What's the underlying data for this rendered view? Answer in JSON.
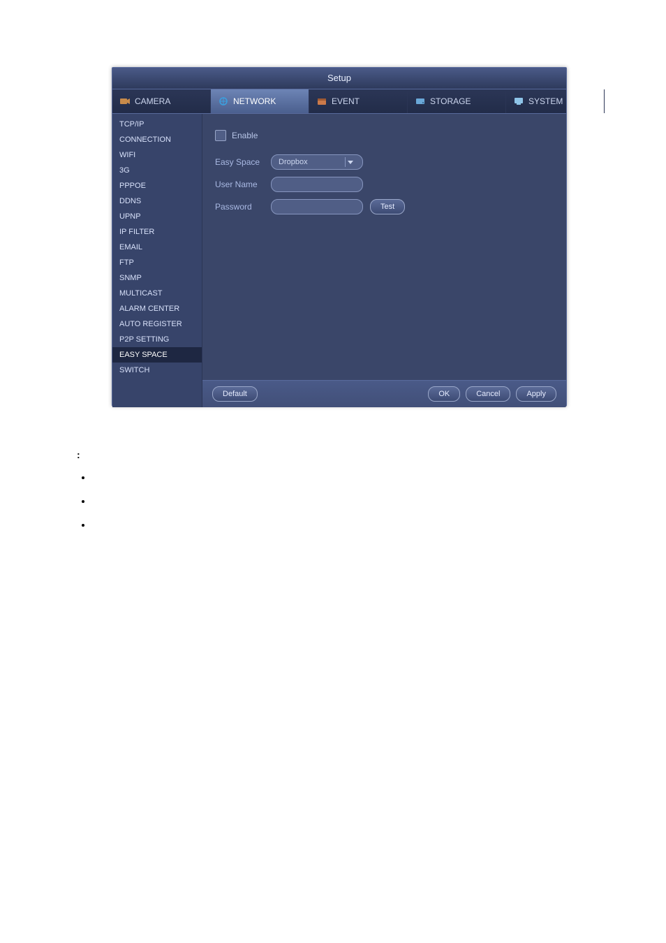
{
  "window": {
    "title": "Setup"
  },
  "tabs": {
    "camera": "CAMERA",
    "network": "NETWORK",
    "event": "EVENT",
    "storage": "STORAGE",
    "system": "SYSTEM"
  },
  "sidebar": {
    "items": [
      "TCP/IP",
      "CONNECTION",
      "WIFI",
      "3G",
      "PPPOE",
      "DDNS",
      "UPNP",
      "IP FILTER",
      "EMAIL",
      "FTP",
      "SNMP",
      "MULTICAST",
      "ALARM CENTER",
      "AUTO REGISTER",
      "P2P SETTING",
      "EASY SPACE",
      "SWITCH"
    ],
    "active_index": 15
  },
  "form": {
    "enable_label": "Enable",
    "easy_space_label": "Easy Space",
    "easy_space_value": "Dropbox",
    "username_label": "User Name",
    "username_value": "",
    "password_label": "Password",
    "password_value": "",
    "test_label": "Test"
  },
  "buttons": {
    "default": "Default",
    "ok": "OK",
    "cancel": "Cancel",
    "apply": "Apply"
  }
}
